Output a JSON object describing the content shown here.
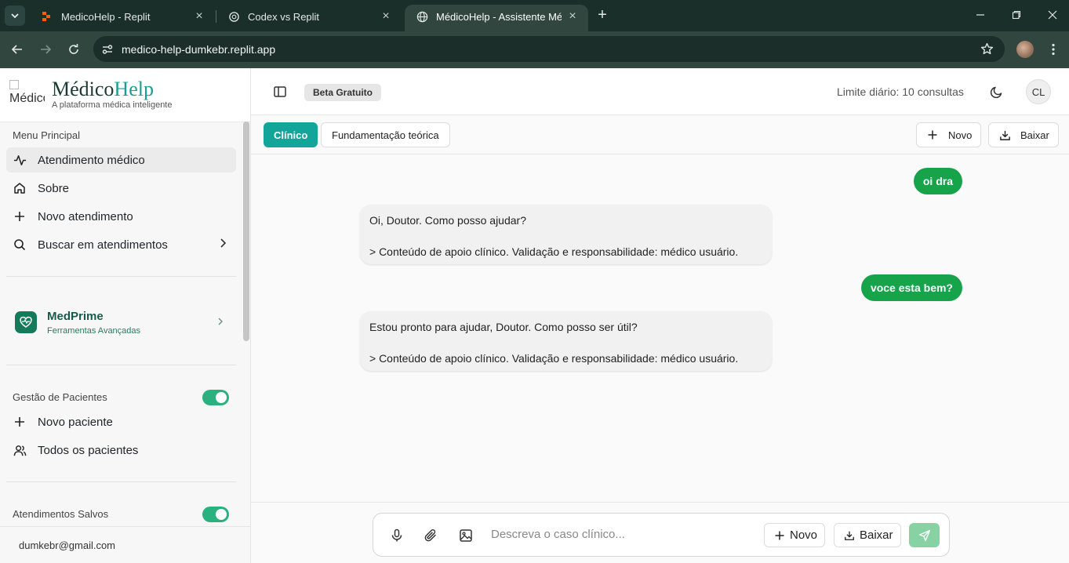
{
  "browser": {
    "tabs": [
      {
        "title": "MedicoHelp - Replit",
        "icon": "replit-icon"
      },
      {
        "title": "Codex vs Replit",
        "icon": "openai-icon"
      },
      {
        "title": "MédicoHelp - Assistente Médico",
        "icon": "globe-icon",
        "active": true
      }
    ],
    "url": "medico-help-dumkebr.replit.app"
  },
  "brand": {
    "logo_alt": "Médico",
    "name_part1": "Médico",
    "name_part2": "Help",
    "tagline": "A plataforma médica inteligente"
  },
  "sidebar": {
    "menu_label": "Menu Principal",
    "items": [
      {
        "label": "Atendimento médico",
        "icon": "activity-icon",
        "active": true
      },
      {
        "label": "Sobre",
        "icon": "home-icon"
      },
      {
        "label": "Novo atendimento",
        "icon": "plus-icon"
      },
      {
        "label": "Buscar em atendimentos",
        "icon": "search-icon"
      }
    ],
    "medprime": {
      "title": "MedPrime",
      "subtitle": "Ferramentas Avançadas"
    },
    "patients": {
      "label": "Gestão de Pacientes",
      "enabled": true,
      "items": [
        {
          "label": "Novo paciente",
          "icon": "plus-icon"
        },
        {
          "label": "Todos os pacientes",
          "icon": "users-icon"
        }
      ]
    },
    "saved": {
      "label": "Atendimentos Salvos",
      "enabled": true
    },
    "user_email": "dumkebr@gmail.com"
  },
  "header": {
    "beta_badge": "Beta Gratuito",
    "limit_text": "Limite diário: 10 consultas",
    "avatar_initials": "CL"
  },
  "modes": {
    "active": "Clínico",
    "inactive": "Fundamentação teórica"
  },
  "toolbar": {
    "new_label": "Novo",
    "download_label": "Baixar"
  },
  "chat": {
    "messages": [
      {
        "role": "user",
        "text": "oi dra"
      },
      {
        "role": "assistant",
        "line1": "Oi, Doutor. Como posso ajudar?",
        "line2": "> Conteúdo de apoio clínico. Validação e responsabilidade: médico usuário."
      },
      {
        "role": "user",
        "text": "voce esta bem?"
      },
      {
        "role": "assistant",
        "line1": "Estou pronto para ajudar, Doutor. Como posso ser útil?",
        "line2": "> Conteúdo de apoio clínico. Validação e responsabilidade: médico usuário."
      }
    ]
  },
  "composer": {
    "placeholder": "Descreva o caso clínico...",
    "new_label": "Novo",
    "download_label": "Baixar"
  },
  "colors": {
    "accent": "#13a49a",
    "user_bubble": "#16a34a",
    "brand_dark": "#1a2f2a"
  }
}
